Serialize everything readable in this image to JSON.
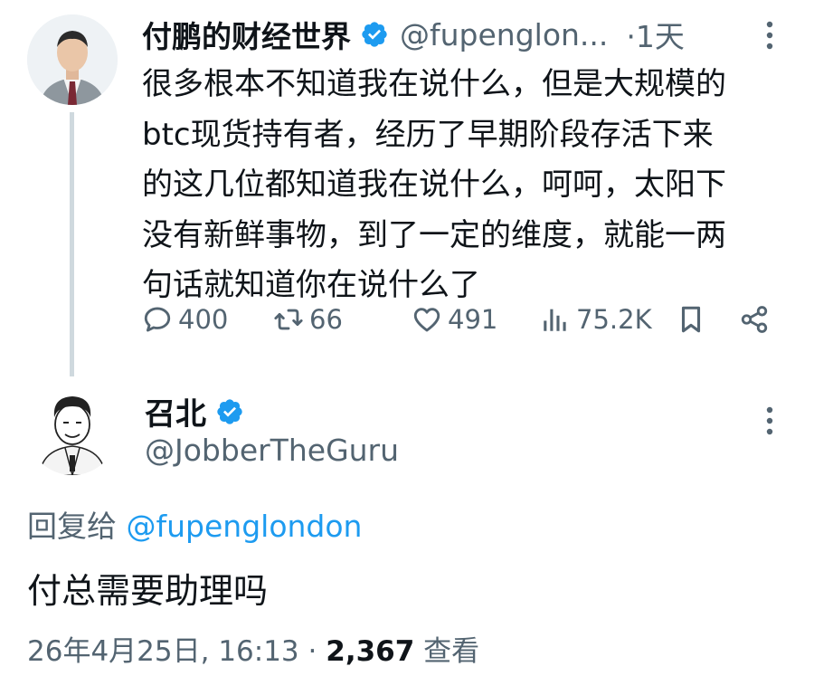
{
  "parent_tweet": {
    "author_name": "付鹏的财经世界",
    "handle": "@fupenglon...",
    "time_sep": "·",
    "time": "1天",
    "text_lines": [
      "很多根本不知道我在说什么，但是大规模的",
      "btc现货持有者，经历了早期阶段存活下来",
      "的这几位都知道我在说什么，呵呵，太阳下",
      "没有新鲜事物，到了一定的维度，就能一两",
      "句话就知道你在说什么了"
    ],
    "actions": {
      "replies": "400",
      "retweets": "66",
      "likes": "491",
      "views": "75.2K"
    },
    "icons": [
      "reply-icon",
      "retweet-icon",
      "like-icon",
      "views-icon",
      "bookmark-icon",
      "share-icon",
      "more-icon"
    ]
  },
  "reply_tweet": {
    "author_name": "召北",
    "handle": "@JobberTheGuru",
    "replying_to_label": "回复给",
    "replying_to_handle": "@fupenglondon",
    "text": "付总需要助理吗",
    "date": "26年4月25日, 16:13",
    "sep": "·",
    "view_count": "2,367",
    "view_label": "查看"
  },
  "colors": {
    "text": "#0f1419",
    "secondary": "#536471",
    "accent": "#1d9bf0",
    "thread_line": "#cfd9de"
  }
}
